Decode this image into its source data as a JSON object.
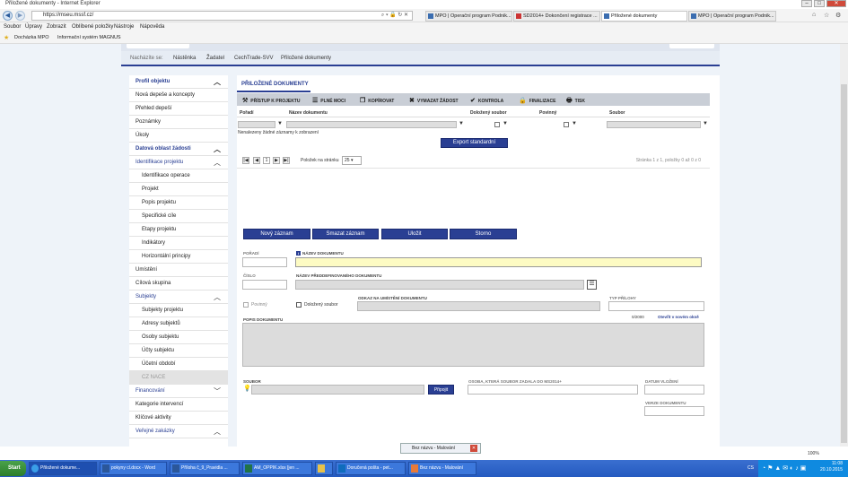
{
  "window_title": "Přiložené dokumenty - Internet Explorer",
  "browser": {
    "address": "https://mseu.mssf.cz/",
    "tabs": [
      {
        "label": "MPO | Operační program Podnik..."
      },
      {
        "label": "SD2014+ Dokončení registrace ..."
      },
      {
        "label": "Přiložené dokumenty"
      },
      {
        "label": "MPO | Operační program Podnik..."
      }
    ],
    "menu": [
      "Soubor",
      "Úpravy",
      "Zobrazit",
      "Oblíbené položky",
      "Nástroje",
      "Nápověda"
    ],
    "favorites": [
      "Docházka MPO",
      "Informační systém MAGNUS"
    ],
    "zoom": "100%"
  },
  "breadcrumb": {
    "label": "Nacházíte se:",
    "items": [
      "Nástěnka",
      "Žadatel",
      "CechTrade-SVV",
      "Přiložené dokumenty"
    ]
  },
  "sidebar": {
    "items": [
      {
        "label": "Profil objektu"
      },
      {
        "label": "Nová depeše a koncepty"
      },
      {
        "label": "Přehled depeší"
      },
      {
        "label": "Poznámky"
      },
      {
        "label": "Úkoly"
      },
      {
        "label": "Datová oblast žádosti"
      },
      {
        "label": "Identifikace projektu"
      },
      {
        "label": "Identifikace operace"
      },
      {
        "label": "Projekt"
      },
      {
        "label": "Popis projektu"
      },
      {
        "label": "Specifické cíle"
      },
      {
        "label": "Etapy projektu"
      },
      {
        "label": "Indikátory"
      },
      {
        "label": "Horizontální principy"
      },
      {
        "label": "Umístění"
      },
      {
        "label": "Cílová skupina"
      },
      {
        "label": "Subjekty"
      },
      {
        "label": "Subjekty projektu"
      },
      {
        "label": "Adresy subjektů"
      },
      {
        "label": "Osoby subjektu"
      },
      {
        "label": "Účty subjektu"
      },
      {
        "label": "Účetní období"
      },
      {
        "label": "CZ NACE"
      },
      {
        "label": "Financování"
      },
      {
        "label": "Kategorie intervencí"
      },
      {
        "label": "Klíčové aktivity"
      },
      {
        "label": "Veřejné zakázky"
      }
    ]
  },
  "main": {
    "title": "PŘILOŽENÉ DOKUMENTY",
    "toolbar": [
      "PŘÍSTUP K PROJEKTU",
      "PLNÉ MOCI",
      "KOPÍROVAT",
      "VYMAZAT ŽÁDOST",
      "KONTROLA",
      "FINALIZACE",
      "TISK"
    ],
    "columns": [
      "Pořadí",
      "Název dokumentu",
      "Doložený soubor",
      "Povinný",
      "Soubor"
    ],
    "empty_text": "Nenalezeny žádné záznamy k zobrazení",
    "export_label": "Export standardní",
    "pager": {
      "current": "1",
      "per_page_label": "Položek na stránku",
      "per_page": "25",
      "status": "Stránka 1 z 1, položky 0 až 0 z 0"
    },
    "buttons": [
      "Nový záznam",
      "Smazat záznam",
      "Uložit",
      "Storno"
    ],
    "form": {
      "poradi": "POŘADÍ",
      "nazev_dokumentu": "NÁZEV DOKUMENTU",
      "cislo": "ČÍSLO",
      "nazev_preddef": "NÁZEV PŘEDDEFINOVANÉHO DOKUMENTU",
      "povinny": "Povinný",
      "dolozeny": "Doložený soubor",
      "odkaz": "ODKAZ NA UMÍSTĚNÍ DOKUMENTU",
      "typ_prilohy": "TYP PŘÍLOHY",
      "popis": "POPIS DOKUMENTU",
      "counter": "0/2000",
      "open_new": "Otevřít v novém okně",
      "soubor": "SOUBOR",
      "pripojit": "Připojit",
      "osoba": "OSOBA, KTERÁ SOUBOR ZADALA DO MS2014+",
      "datum": "DATUM VLOŽENÍ",
      "verze": "VERZE DOKUMENTU"
    }
  },
  "popup": {
    "label": "Bez názvu - Malování"
  },
  "taskbar": {
    "start": "Start",
    "items": [
      "Přiložené dokume...",
      "pokyny cl.docx - Word",
      "Příloha č_9_Pravidla ...",
      "AM_OPPIK.xlsx [jen ...",
      "",
      "Doručená pošta - pet...",
      "Bez názvu - Malování"
    ],
    "lang": "CS",
    "time": "11:08",
    "date": "20.10.2015"
  }
}
